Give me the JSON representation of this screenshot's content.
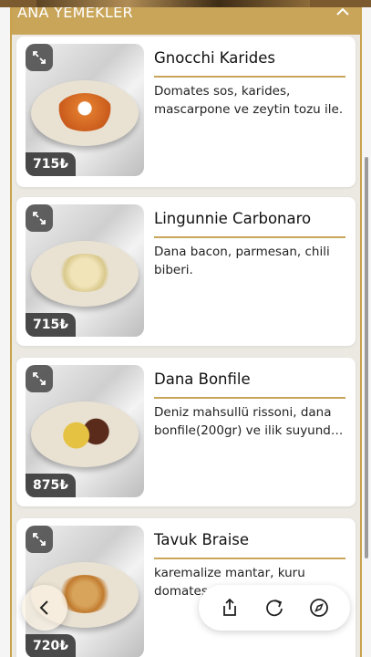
{
  "section": {
    "title": "ANA YEMEKLER"
  },
  "items": [
    {
      "name": "Gnocchi Karides",
      "description": "Domates sos, karides, mascarpone ve zeytin tozu ile.",
      "price": "715₺"
    },
    {
      "name": "Lingunnie Carbonaro",
      "description": "Dana bacon, parmesan, chili biberi.",
      "price": "715₺"
    },
    {
      "name": "Dana Bonfile",
      "description": "Deniz mahsullü rissoni, dana bonfile(200gr) ve ilik suyund…",
      "price": "875₺"
    },
    {
      "name": "Tavuk Braise",
      "description": "karemalize mantar, kuru domates sote, ...",
      "price": "720₺"
    }
  ],
  "icons": {
    "collapse": "chevron-up-icon",
    "expand": "expand-icon",
    "back": "chevron-left-icon",
    "share": "share-icon",
    "reload": "reload-icon",
    "browser": "compass-icon"
  },
  "colors": {
    "accent": "#c9a55a",
    "panel": "#ece9e3"
  }
}
